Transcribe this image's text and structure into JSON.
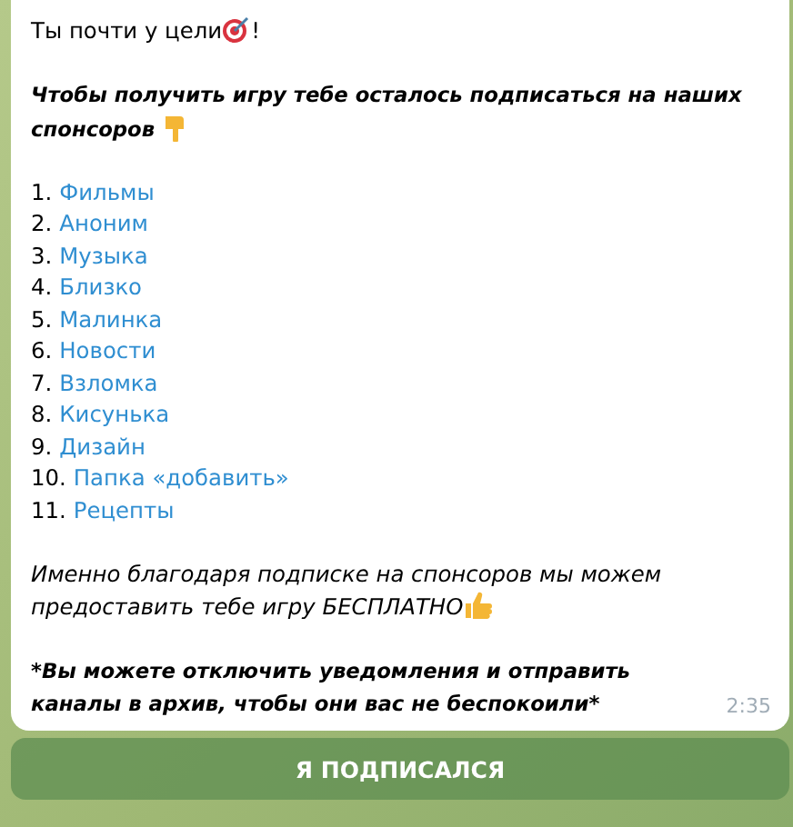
{
  "message": {
    "greeting": "Ты почти у цели",
    "greeting_end": "!",
    "instruction": [
      "Чтобы получить игру тебе осталось подписаться на наших",
      "спонсоров"
    ],
    "sponsors": [
      {
        "number": "1.",
        "name": "Фильмы"
      },
      {
        "number": "2.",
        "name": "Аноним"
      },
      {
        "number": "3.",
        "name": "Музыка"
      },
      {
        "number": "4.",
        "name": "Близко"
      },
      {
        "number": "5.",
        "name": "Малинка"
      },
      {
        "number": "6.",
        "name": "Новости"
      },
      {
        "number": "7.",
        "name": "Взломка"
      },
      {
        "number": "8.",
        "name": "Кисунька"
      },
      {
        "number": "9.",
        "name": "Дизайн"
      },
      {
        "number": "10.",
        "name": "Папка «добавить»"
      },
      {
        "number": "11.",
        "name": "Рецепты"
      }
    ],
    "note": [
      "Именно благодаря подписке на спонсоров мы можем",
      "предоставить тебе игру БЕСПЛАТНО"
    ],
    "footnote": "*Вы можете отключить уведомления и отправить каналы в архив, чтобы они вас не беспокоили*",
    "time": "2:35"
  },
  "button": {
    "label": "Я ПОДПИСАЛСЯ"
  }
}
